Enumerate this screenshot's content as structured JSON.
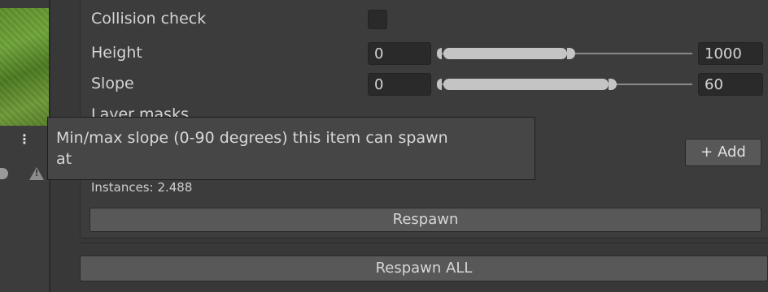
{
  "rows": {
    "collision": {
      "label": "Collision check"
    },
    "height": {
      "label": "Height",
      "min": "0",
      "max": "1000"
    },
    "slope": {
      "label": "Slope",
      "min": "0",
      "max": "60"
    },
    "layer": {
      "label": "Layer masks"
    }
  },
  "tooltip": {
    "line1": "Min/max slope (0-90 degrees) this item can spawn",
    "line2": "at"
  },
  "add_button": {
    "icon": "plus-icon",
    "label": "+ Add"
  },
  "instances": "Instances: 2.488",
  "buttons": {
    "respawn": "Respawn",
    "respawn_all": "Respawn ALL"
  },
  "icons": {
    "menu": "kebab-menu-icon",
    "warning": "warning-icon"
  },
  "colors": {
    "background": "#383838",
    "field": "#2a2a2a",
    "button": "#585858",
    "slider_fill": "#c4c4c4"
  }
}
